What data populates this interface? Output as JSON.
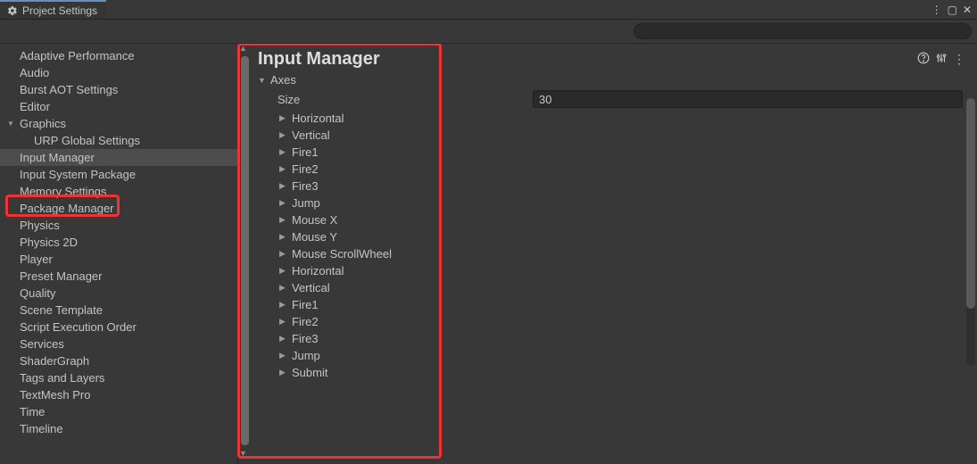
{
  "window": {
    "title": "Project Settings"
  },
  "search": {
    "placeholder": ""
  },
  "sidebar": {
    "items": [
      {
        "label": "Adaptive Performance",
        "expandable": false,
        "indent": 0
      },
      {
        "label": "Audio",
        "expandable": false,
        "indent": 0
      },
      {
        "label": "Burst AOT Settings",
        "expandable": false,
        "indent": 0
      },
      {
        "label": "Editor",
        "expandable": false,
        "indent": 0
      },
      {
        "label": "Graphics",
        "expandable": true,
        "indent": 0
      },
      {
        "label": "URP Global Settings",
        "expandable": false,
        "indent": 1
      },
      {
        "label": "Input Manager",
        "expandable": false,
        "indent": 0,
        "selected": true
      },
      {
        "label": "Input System Package",
        "expandable": false,
        "indent": 0
      },
      {
        "label": "Memory Settings",
        "expandable": false,
        "indent": 0
      },
      {
        "label": "Package Manager",
        "expandable": false,
        "indent": 0
      },
      {
        "label": "Physics",
        "expandable": false,
        "indent": 0
      },
      {
        "label": "Physics 2D",
        "expandable": false,
        "indent": 0
      },
      {
        "label": "Player",
        "expandable": false,
        "indent": 0
      },
      {
        "label": "Preset Manager",
        "expandable": false,
        "indent": 0
      },
      {
        "label": "Quality",
        "expandable": false,
        "indent": 0
      },
      {
        "label": "Scene Template",
        "expandable": false,
        "indent": 0
      },
      {
        "label": "Script Execution Order",
        "expandable": false,
        "indent": 0
      },
      {
        "label": "Services",
        "expandable": false,
        "indent": 0
      },
      {
        "label": "ShaderGraph",
        "expandable": false,
        "indent": 0
      },
      {
        "label": "Tags and Layers",
        "expandable": false,
        "indent": 0
      },
      {
        "label": "TextMesh Pro",
        "expandable": false,
        "indent": 0
      },
      {
        "label": "Time",
        "expandable": false,
        "indent": 0
      },
      {
        "label": "Timeline",
        "expandable": false,
        "indent": 0
      }
    ]
  },
  "inspector": {
    "title": "Input Manager",
    "axes_label": "Axes",
    "size_label": "Size",
    "size_value": "30",
    "axes": [
      "Horizontal",
      "Vertical",
      "Fire1",
      "Fire2",
      "Fire3",
      "Jump",
      "Mouse X",
      "Mouse Y",
      "Mouse ScrollWheel",
      "Horizontal",
      "Vertical",
      "Fire1",
      "Fire2",
      "Fire3",
      "Jump",
      "Submit"
    ]
  },
  "header_icons": {
    "help": "?",
    "preset": "⇅",
    "menu": "⋮"
  },
  "win_icons": {
    "menu": "⋮",
    "max": "▢",
    "close": "✕"
  }
}
